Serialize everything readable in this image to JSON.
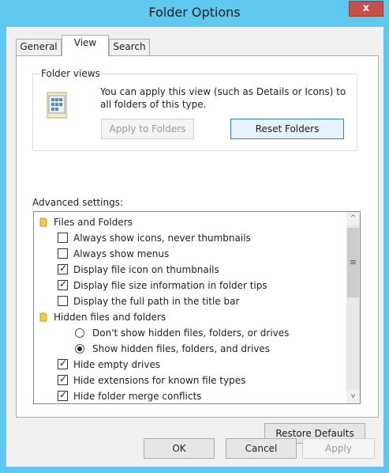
{
  "window": {
    "title": "Folder Options",
    "close_glyph": "x"
  },
  "tabs": [
    {
      "label": "General"
    },
    {
      "label": "View"
    },
    {
      "label": "Search"
    }
  ],
  "folder_views": {
    "legend": "Folder views",
    "description": "You can apply this view (such as Details or Icons) to all folders of this type.",
    "apply_label": "Apply to Folders",
    "reset_label": "Reset Folders",
    "icon": "folder-views-icon"
  },
  "advanced": {
    "label": "Advanced settings:",
    "items": [
      {
        "kind": "folder",
        "label": "Files and Folders"
      },
      {
        "kind": "checkbox",
        "label": "Always show icons, never thumbnails",
        "checked": false
      },
      {
        "kind": "checkbox",
        "label": "Always show menus",
        "checked": false
      },
      {
        "kind": "checkbox",
        "label": "Display file icon on thumbnails",
        "checked": true
      },
      {
        "kind": "checkbox",
        "label": "Display file size information in folder tips",
        "checked": true
      },
      {
        "kind": "checkbox",
        "label": "Display the full path in the title bar",
        "checked": false
      },
      {
        "kind": "folder",
        "label": "Hidden files and folders"
      },
      {
        "kind": "radio",
        "label": "Don't show hidden files, folders, or drives",
        "checked": false
      },
      {
        "kind": "radio",
        "label": "Show hidden files, folders, and drives",
        "checked": true
      },
      {
        "kind": "checkbox",
        "label": "Hide empty drives",
        "checked": true
      },
      {
        "kind": "checkbox",
        "label": "Hide extensions for known file types",
        "checked": true
      },
      {
        "kind": "checkbox",
        "label": "Hide folder merge conflicts",
        "checked": true
      }
    ]
  },
  "scrollbar": {
    "up_glyph": "^",
    "down_glyph": "v",
    "thumb_glyph": "≡"
  },
  "buttons": {
    "restore_defaults": "Restore Defaults",
    "ok": "OK",
    "cancel": "Cancel",
    "apply": "Apply"
  },
  "colors": {
    "frame": "#5ec8ee",
    "close": "#c7504b",
    "focus": "#3c7fb1"
  }
}
